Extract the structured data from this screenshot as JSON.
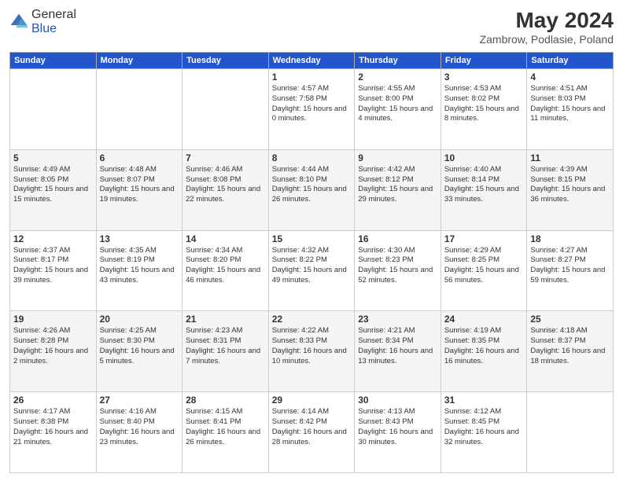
{
  "header": {
    "logo_general": "General",
    "logo_blue": "Blue",
    "main_title": "May 2024",
    "subtitle": "Zambrow, Podlasie, Poland"
  },
  "days_of_week": [
    "Sunday",
    "Monday",
    "Tuesday",
    "Wednesday",
    "Thursday",
    "Friday",
    "Saturday"
  ],
  "weeks": [
    [
      {
        "day": "",
        "info": ""
      },
      {
        "day": "",
        "info": ""
      },
      {
        "day": "",
        "info": ""
      },
      {
        "day": "1",
        "info": "Sunrise: 4:57 AM\nSunset: 7:58 PM\nDaylight: 15 hours\nand 0 minutes."
      },
      {
        "day": "2",
        "info": "Sunrise: 4:55 AM\nSunset: 8:00 PM\nDaylight: 15 hours\nand 4 minutes."
      },
      {
        "day": "3",
        "info": "Sunrise: 4:53 AM\nSunset: 8:02 PM\nDaylight: 15 hours\nand 8 minutes."
      },
      {
        "day": "4",
        "info": "Sunrise: 4:51 AM\nSunset: 8:03 PM\nDaylight: 15 hours\nand 11 minutes."
      }
    ],
    [
      {
        "day": "5",
        "info": "Sunrise: 4:49 AM\nSunset: 8:05 PM\nDaylight: 15 hours\nand 15 minutes."
      },
      {
        "day": "6",
        "info": "Sunrise: 4:48 AM\nSunset: 8:07 PM\nDaylight: 15 hours\nand 19 minutes."
      },
      {
        "day": "7",
        "info": "Sunrise: 4:46 AM\nSunset: 8:08 PM\nDaylight: 15 hours\nand 22 minutes."
      },
      {
        "day": "8",
        "info": "Sunrise: 4:44 AM\nSunset: 8:10 PM\nDaylight: 15 hours\nand 26 minutes."
      },
      {
        "day": "9",
        "info": "Sunrise: 4:42 AM\nSunset: 8:12 PM\nDaylight: 15 hours\nand 29 minutes."
      },
      {
        "day": "10",
        "info": "Sunrise: 4:40 AM\nSunset: 8:14 PM\nDaylight: 15 hours\nand 33 minutes."
      },
      {
        "day": "11",
        "info": "Sunrise: 4:39 AM\nSunset: 8:15 PM\nDaylight: 15 hours\nand 36 minutes."
      }
    ],
    [
      {
        "day": "12",
        "info": "Sunrise: 4:37 AM\nSunset: 8:17 PM\nDaylight: 15 hours\nand 39 minutes."
      },
      {
        "day": "13",
        "info": "Sunrise: 4:35 AM\nSunset: 8:19 PM\nDaylight: 15 hours\nand 43 minutes."
      },
      {
        "day": "14",
        "info": "Sunrise: 4:34 AM\nSunset: 8:20 PM\nDaylight: 15 hours\nand 46 minutes."
      },
      {
        "day": "15",
        "info": "Sunrise: 4:32 AM\nSunset: 8:22 PM\nDaylight: 15 hours\nand 49 minutes."
      },
      {
        "day": "16",
        "info": "Sunrise: 4:30 AM\nSunset: 8:23 PM\nDaylight: 15 hours\nand 52 minutes."
      },
      {
        "day": "17",
        "info": "Sunrise: 4:29 AM\nSunset: 8:25 PM\nDaylight: 15 hours\nand 56 minutes."
      },
      {
        "day": "18",
        "info": "Sunrise: 4:27 AM\nSunset: 8:27 PM\nDaylight: 15 hours\nand 59 minutes."
      }
    ],
    [
      {
        "day": "19",
        "info": "Sunrise: 4:26 AM\nSunset: 8:28 PM\nDaylight: 16 hours\nand 2 minutes."
      },
      {
        "day": "20",
        "info": "Sunrise: 4:25 AM\nSunset: 8:30 PM\nDaylight: 16 hours\nand 5 minutes."
      },
      {
        "day": "21",
        "info": "Sunrise: 4:23 AM\nSunset: 8:31 PM\nDaylight: 16 hours\nand 7 minutes."
      },
      {
        "day": "22",
        "info": "Sunrise: 4:22 AM\nSunset: 8:33 PM\nDaylight: 16 hours\nand 10 minutes."
      },
      {
        "day": "23",
        "info": "Sunrise: 4:21 AM\nSunset: 8:34 PM\nDaylight: 16 hours\nand 13 minutes."
      },
      {
        "day": "24",
        "info": "Sunrise: 4:19 AM\nSunset: 8:35 PM\nDaylight: 16 hours\nand 16 minutes."
      },
      {
        "day": "25",
        "info": "Sunrise: 4:18 AM\nSunset: 8:37 PM\nDaylight: 16 hours\nand 18 minutes."
      }
    ],
    [
      {
        "day": "26",
        "info": "Sunrise: 4:17 AM\nSunset: 8:38 PM\nDaylight: 16 hours\nand 21 minutes."
      },
      {
        "day": "27",
        "info": "Sunrise: 4:16 AM\nSunset: 8:40 PM\nDaylight: 16 hours\nand 23 minutes."
      },
      {
        "day": "28",
        "info": "Sunrise: 4:15 AM\nSunset: 8:41 PM\nDaylight: 16 hours\nand 26 minutes."
      },
      {
        "day": "29",
        "info": "Sunrise: 4:14 AM\nSunset: 8:42 PM\nDaylight: 16 hours\nand 28 minutes."
      },
      {
        "day": "30",
        "info": "Sunrise: 4:13 AM\nSunset: 8:43 PM\nDaylight: 16 hours\nand 30 minutes."
      },
      {
        "day": "31",
        "info": "Sunrise: 4:12 AM\nSunset: 8:45 PM\nDaylight: 16 hours\nand 32 minutes."
      },
      {
        "day": "",
        "info": ""
      }
    ]
  ]
}
